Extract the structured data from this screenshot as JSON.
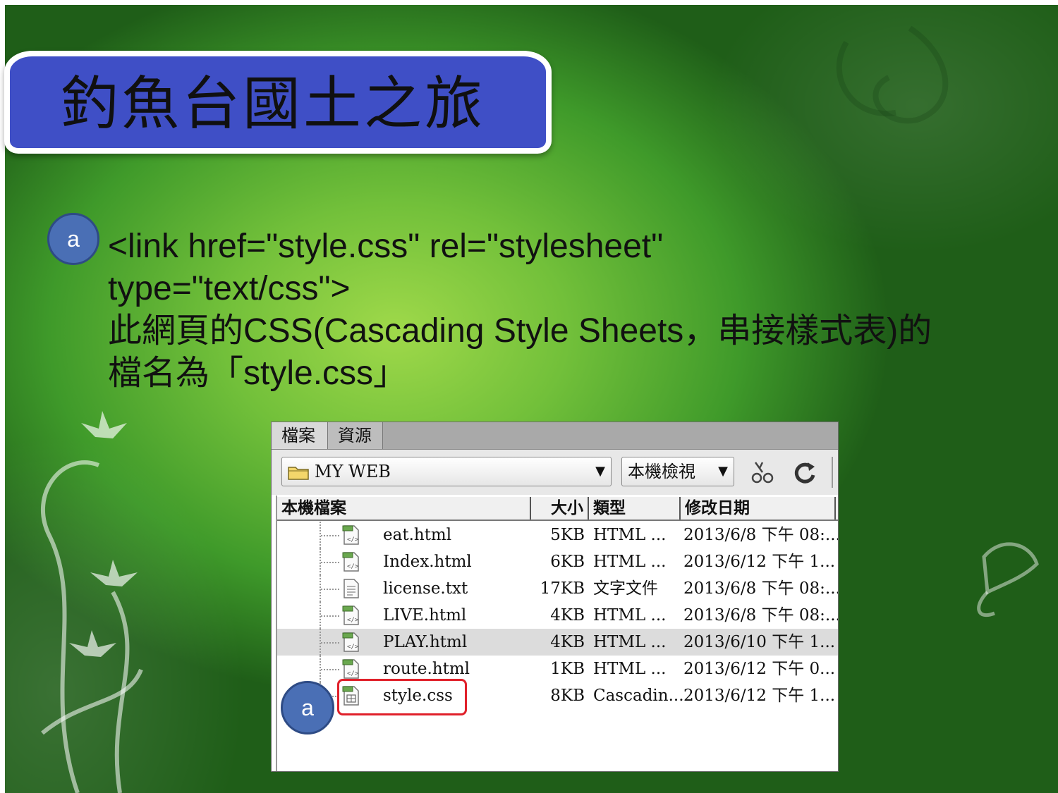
{
  "slide": {
    "title": "釣魚台國土之旅",
    "bullet_marker": "a",
    "body_lines": [
      "<link href=\"style.css\" rel=\"stylesheet\"",
      "type=\"text/css\">",
      "此網頁的CSS(Cascading Style Sheets，串接樣式表)的",
      "檔名為「style.css」"
    ]
  },
  "file_panel": {
    "tabs": [
      "檔案",
      "資源"
    ],
    "site_select": "MY WEB",
    "view_select": "本機檢視",
    "columns": {
      "name": "本機檔案",
      "size": "大小",
      "type": "類型",
      "modified": "修改日期"
    },
    "files": [
      {
        "name": "eat.html",
        "size": "5KB",
        "type": "HTML ...",
        "modified": "2013/6/8 下午 08:...",
        "icon": "html-file-icon"
      },
      {
        "name": "Index.html",
        "size": "6KB",
        "type": "HTML ...",
        "modified": "2013/6/12 下午 1...",
        "icon": "html-file-icon"
      },
      {
        "name": "license.txt",
        "size": "17KB",
        "type": "文字文件",
        "modified": "2013/6/8 下午 08:...",
        "icon": "text-file-icon"
      },
      {
        "name": "LIVE.html",
        "size": "4KB",
        "type": "HTML ...",
        "modified": "2013/6/8 下午 08:...",
        "icon": "html-file-icon"
      },
      {
        "name": "PLAY.html",
        "size": "4KB",
        "type": "HTML ...",
        "modified": "2013/6/10 下午 1...",
        "icon": "html-file-icon",
        "selected": true
      },
      {
        "name": "route.html",
        "size": "1KB",
        "type": "HTML ...",
        "modified": "2013/6/12 下午 0...",
        "icon": "html-file-icon"
      },
      {
        "name": "style.css",
        "size": "8KB",
        "type": "Cascadin...",
        "modified": "2013/6/12 下午 1...",
        "icon": "css-file-icon"
      }
    ],
    "callout_marker": "a"
  },
  "colors": {
    "banner": "#3f4fc6",
    "bullet": "#4a6fb5",
    "highlight": "#e0202a"
  }
}
